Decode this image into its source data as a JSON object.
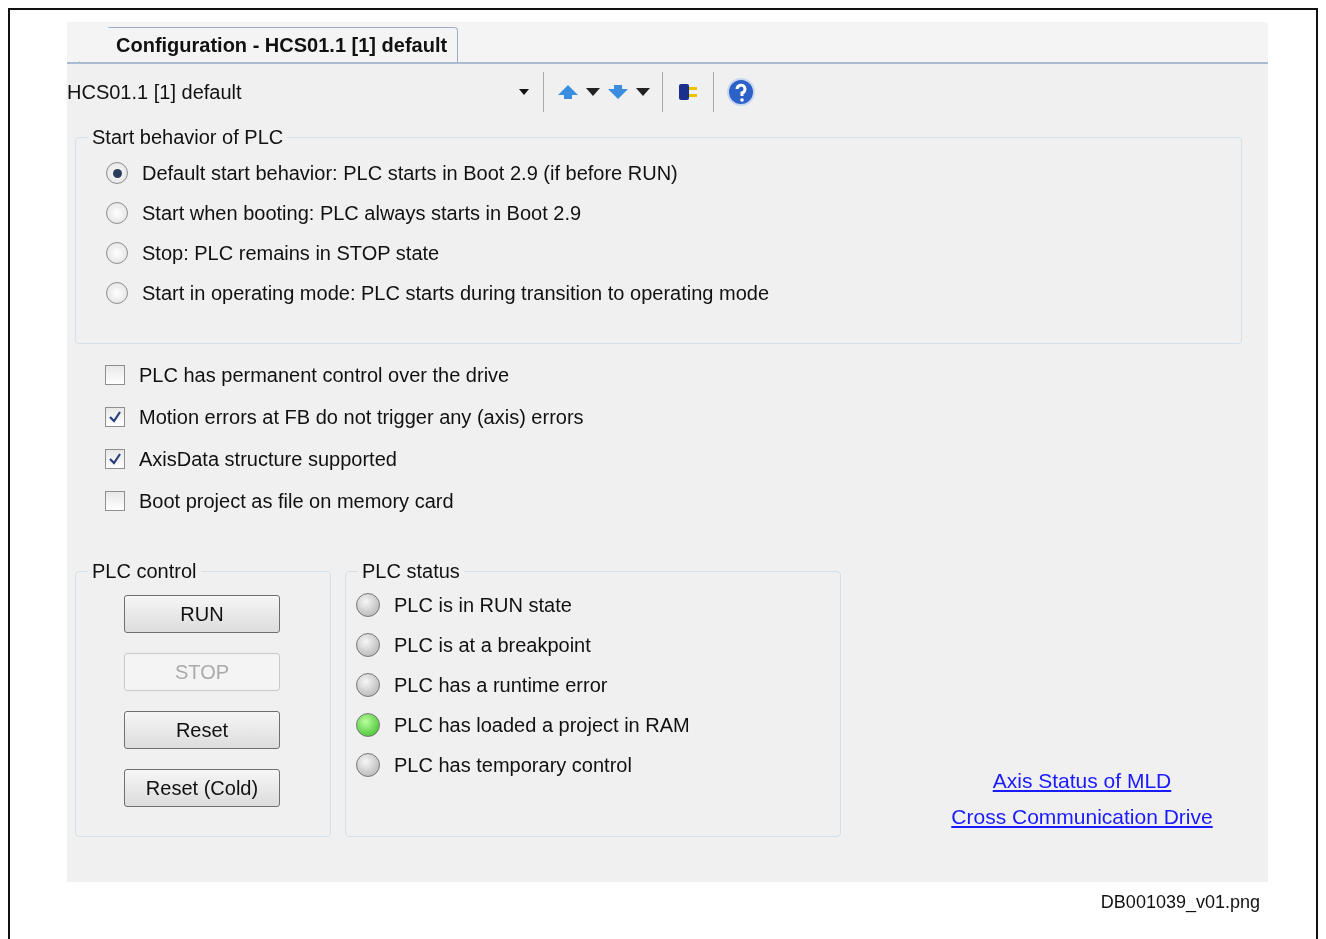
{
  "tab": {
    "label": "Configuration - HCS01.1 [1] default",
    "selected": true
  },
  "toolbar": {
    "device": "HCS01.1 [1] default"
  },
  "start_behavior": {
    "title": "Start behavior of PLC",
    "options": [
      {
        "label": "Default start behavior: PLC starts in Boot 2.9 (if before RUN)",
        "selected": true
      },
      {
        "label": "Start when booting: PLC always starts in Boot 2.9",
        "selected": false
      },
      {
        "label": "Stop: PLC remains in STOP state",
        "selected": false
      },
      {
        "label": "Start in operating mode: PLC starts during transition to operating mode",
        "selected": false
      }
    ]
  },
  "options": [
    {
      "label": "PLC has permanent control over the drive",
      "checked": false
    },
    {
      "label": "Motion errors at FB do not trigger any (axis) errors",
      "checked": true
    },
    {
      "label": "AxisData structure supported",
      "checked": true
    },
    {
      "label": "Boot project as file on memory card",
      "checked": false
    }
  ],
  "plc_control": {
    "title": "PLC control",
    "buttons": [
      {
        "label": "RUN",
        "disabled": false
      },
      {
        "label": "STOP",
        "disabled": true
      },
      {
        "label": "Reset",
        "disabled": false
      },
      {
        "label": "Reset (Cold)",
        "disabled": false
      }
    ]
  },
  "plc_status": {
    "title": "PLC status",
    "lamps": [
      {
        "label": "PLC is in RUN state",
        "on": false
      },
      {
        "label": "PLC is at a breakpoint",
        "on": false
      },
      {
        "label": "PLC has a runtime error",
        "on": false
      },
      {
        "label": "PLC has loaded a project in RAM",
        "on": true
      },
      {
        "label": "PLC has temporary control",
        "on": false
      }
    ]
  },
  "links": [
    "Axis Status of MLD",
    "Cross Communication Drive"
  ],
  "caption": "DB001039_v01.png"
}
